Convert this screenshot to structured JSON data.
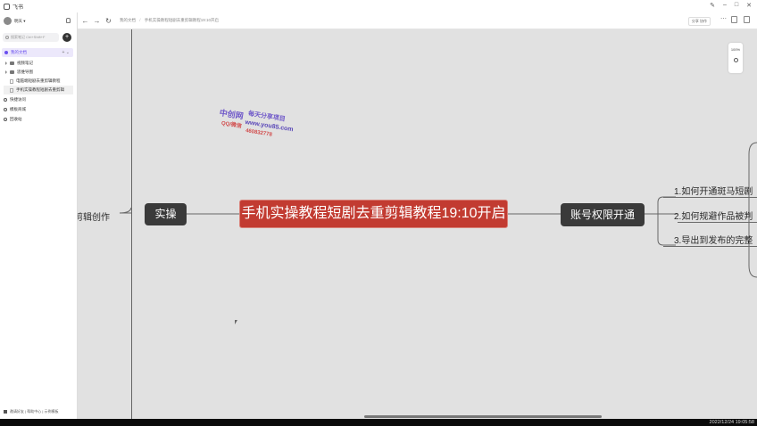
{
  "window": {
    "title": "飞书"
  },
  "sidebar": {
    "user_name": "明天 ▾",
    "search_placeholder": "搜索笔记 Ctrl+Shift+F",
    "plus_label": "+",
    "root_label": "我的文档",
    "root_actions": "+ ⌄",
    "items": [
      {
        "label": "视频笔记"
      },
      {
        "label": "思维导图"
      },
      {
        "label": "电脑端短剧去重剪辑教程"
      },
      {
        "label": "手机实操教程短剧去重剪辑"
      }
    ],
    "nav": [
      {
        "label": "快捷访问"
      },
      {
        "label": "模板商城"
      },
      {
        "label": "回收站"
      }
    ],
    "footer_text": "邀请好友 | 帮助中心 | 示例模板"
  },
  "topbar": {
    "breadcrumb_root": "我的文档",
    "breadcrumb_sep": "/",
    "breadcrumb_current": "手机实操教程短剧去重剪辑教程19:10开启",
    "share_label": "分享 协作",
    "more_label": "⋯"
  },
  "canvas": {
    "zoom": "100%",
    "main_node": "手机实操教程短剧去重剪辑教程19:10开启",
    "left_node": "实操",
    "far_left_text": "剪辑创作",
    "right_node": "账号权限开通",
    "right_leaves": [
      "1.如何开通斑马短剧",
      "2.如何规避作品被判",
      "3.导出到发布的完整"
    ]
  },
  "watermark": {
    "brand": "中创网",
    "slogan": "每天分享项目",
    "site": "www.you85.com",
    "contact_prefix": "QQ/微信",
    "contact_number": "460832778"
  },
  "taskbar": {
    "timestamp": "2022/12/24 19:05:58"
  },
  "colors": {
    "main_node": "#c23b31",
    "dark_node": "#3a3a3a",
    "accent": "#6a4ff0",
    "canvas_bg": "#e1e1e1"
  }
}
